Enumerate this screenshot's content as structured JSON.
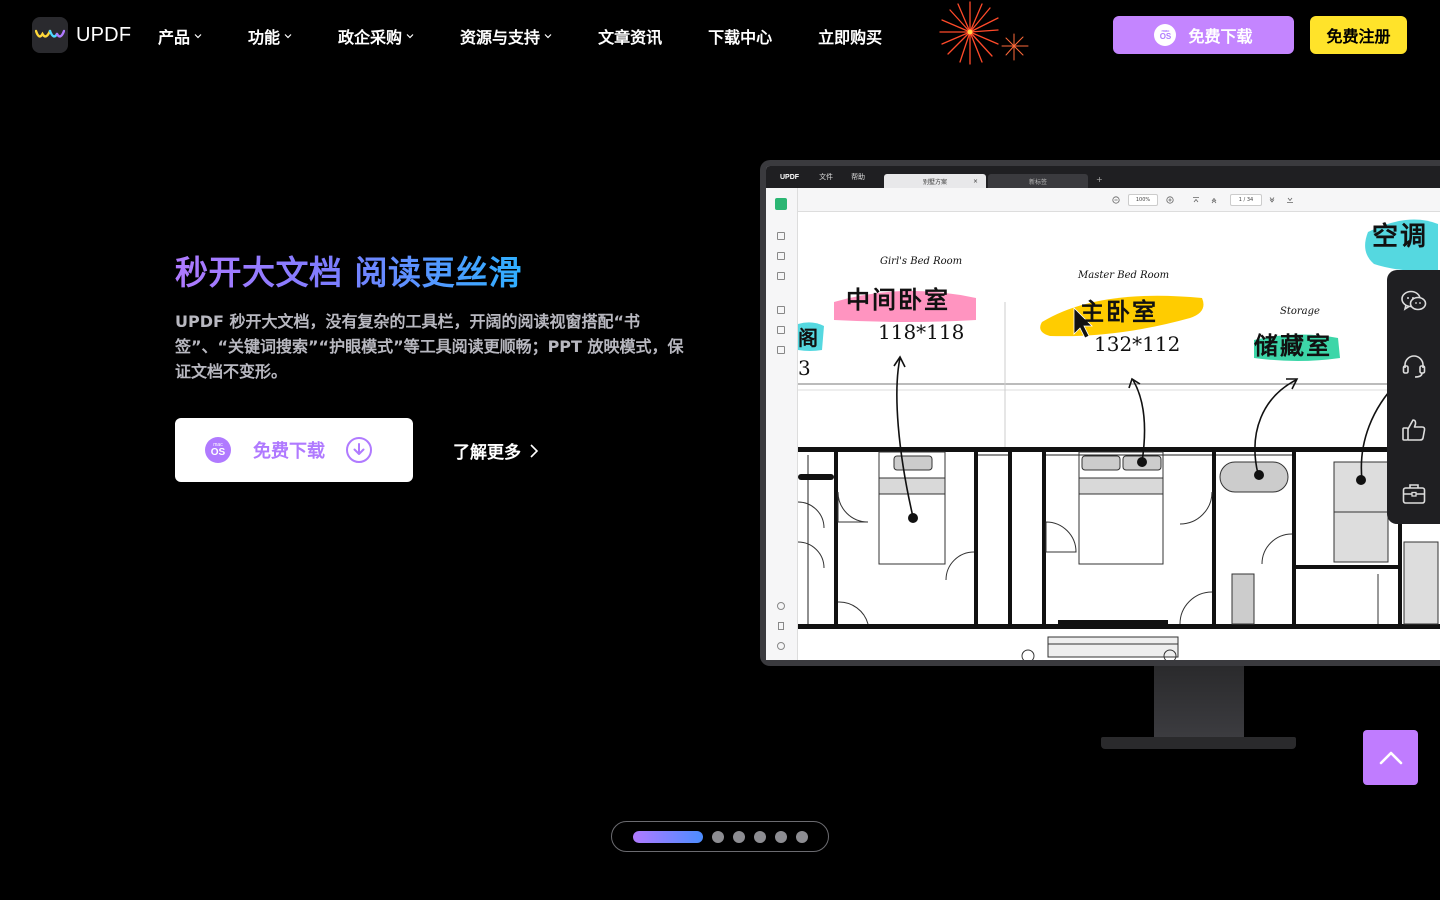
{
  "header": {
    "logo_text": "UPDF",
    "nav": [
      {
        "label": "产品",
        "dropdown": true
      },
      {
        "label": "功能",
        "dropdown": true
      },
      {
        "label": "政企采购",
        "dropdown": true
      },
      {
        "label": "资源与支持",
        "dropdown": true
      },
      {
        "label": "文章资讯",
        "dropdown": false
      },
      {
        "label": "下载中心",
        "dropdown": false
      },
      {
        "label": "立即购买",
        "dropdown": false
      }
    ],
    "download_label": "免费下载",
    "mac_badge_top": "mac",
    "mac_badge_bottom": "OS",
    "register_label": "免费注册"
  },
  "hero": {
    "title": "秒开大文档 阅读更丝滑",
    "description": "UPDF 秒开大文档，没有复杂的工具栏，开阔的阅读视窗搭配“书签”、“关键词搜索”“护眼模式”等工具阅读更顺畅；PPT 放映模式，保证文档不变形。",
    "download_label": "免费下载",
    "learn_more_label": "了解更多"
  },
  "app_preview": {
    "logo": "UPDF",
    "menu_file": "文件",
    "menu_help": "帮助",
    "tab_active": "别墅方案",
    "tab_close": "×",
    "tab_new": "新标签",
    "tab_add": "+",
    "zoom": "100%",
    "pages": "1 / 34",
    "annotations": {
      "girls_room_en": "Girl's Bed Room",
      "girls_room_cn": "中间卧室",
      "girls_room_size": "118*118",
      "master_room_en": "Master Bed Room",
      "master_room_cn": "主卧室",
      "master_room_size": "132*112",
      "storage_en": "Storage",
      "storage_cn": "储藏室",
      "ac_cn": "空调",
      "left_cn": "阁",
      "left_num": "3"
    }
  },
  "float_panel": {
    "icons": [
      "wechat-icon",
      "headset-icon",
      "thumbs-up-icon",
      "toolbox-icon"
    ]
  },
  "carousel": {
    "total": 6,
    "active": 1
  },
  "colors": {
    "accent_purple": "#c485ff",
    "register_yellow": "#ffe32a",
    "background": "#000000"
  }
}
